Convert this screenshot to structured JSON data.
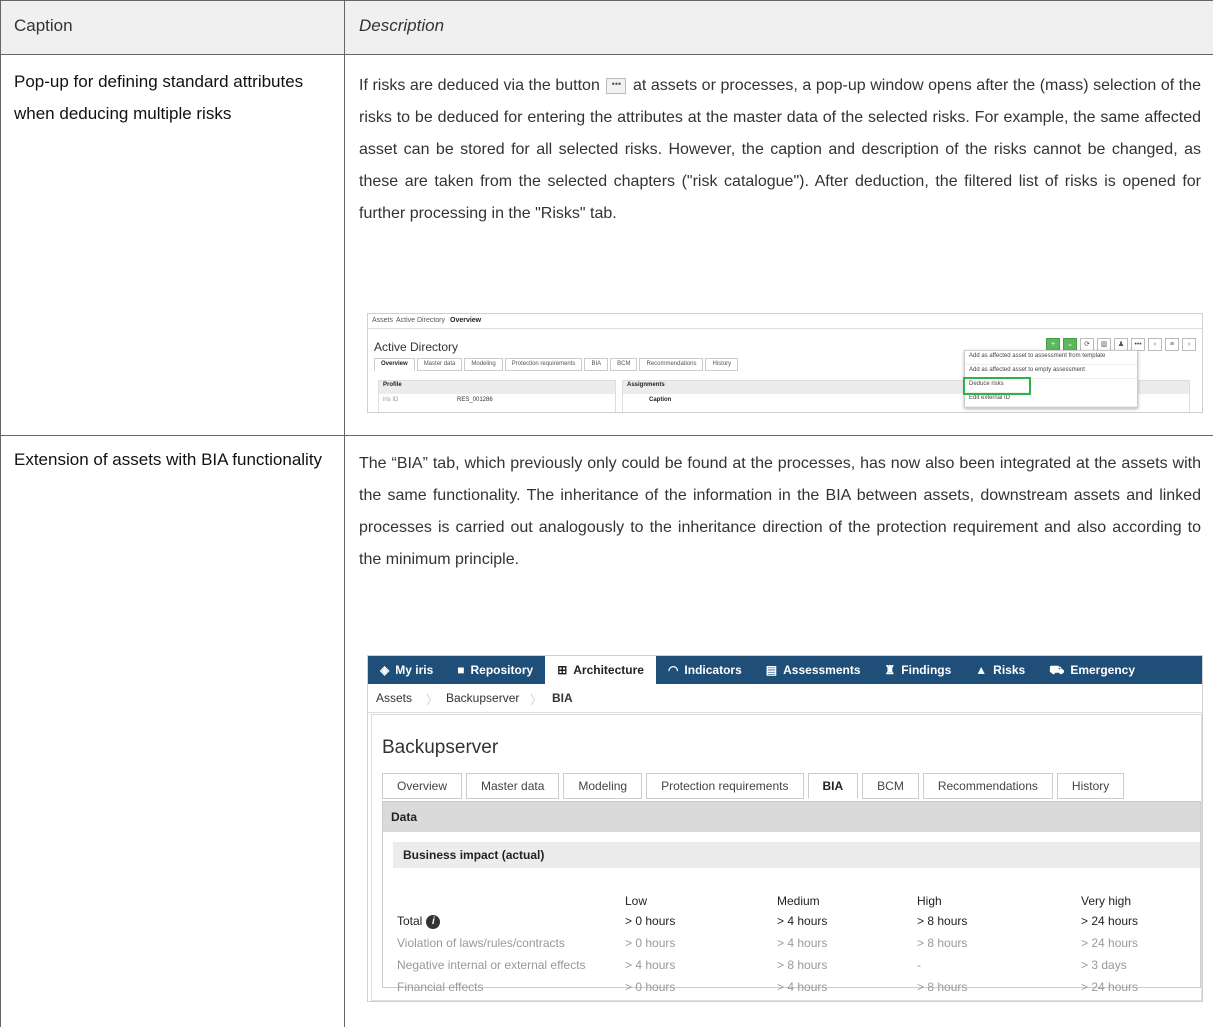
{
  "header": {
    "caption": "Caption",
    "description": "Description"
  },
  "row1": {
    "caption": "Pop-up for defining standard attributes when deducing multiple risks",
    "para_part1": "If risks are deduced via the button",
    "para_part2": "at assets or processes, a pop-up window opens after the (mass) selection of the risks to be deduced for entering the attributes at the master data of the selected risks. For example, the same affected asset can be stored for all selected risks. However, the caption and description of the risks cannot be changed, as these are taken from the selected chapters (\"risk catalogue\"). After deduction, the filtered list of risks is opened for further processing in the \"Risks\" tab.",
    "inline_button_icon": "more-dots-icon",
    "screenshot": {
      "breadcrumb": [
        "Assets",
        "Active Directory",
        "Overview"
      ],
      "title": "Active Directory",
      "tabs": [
        "Overview",
        "Master data",
        "Modeling",
        "Protection requirements",
        "BIA",
        "BCM",
        "Recommendations",
        "History"
      ],
      "left_panel_header": "Profile",
      "left_label": "iris ID",
      "left_value": "RES_001286",
      "right_panel_header": "Assignments",
      "right_col": "Caption",
      "menu_items": [
        "Add as affected asset to assessment from template",
        "Add as affected asset to empty assessment",
        "Deduce risks",
        "Edit external ID"
      ],
      "highlight_color": "#2db34a"
    }
  },
  "row2": {
    "caption": "Extension of assets with BIA functionality",
    "para": "The “BIA” tab, which previously only could be found at the processes, has now also been integrated at the assets with the same functionality. The inheritance of the information in the BIA between assets, downstream assets and linked processes is carried out analogously to the inheritance direction of the protection requirement and also according to the minimum principle.",
    "screenshot": {
      "nav": [
        {
          "label": "My iris",
          "icon": "diamond-icon",
          "glyph": "◈"
        },
        {
          "label": "Repository",
          "icon": "book-icon",
          "glyph": "■"
        },
        {
          "label": "Architecture",
          "icon": "sitemap-icon",
          "glyph": "⊞"
        },
        {
          "label": "Indicators",
          "icon": "gauge-icon",
          "glyph": "◠"
        },
        {
          "label": "Assessments",
          "icon": "clipboard-icon",
          "glyph": "▤"
        },
        {
          "label": "Findings",
          "icon": "binoculars-icon",
          "glyph": "♜"
        },
        {
          "label": "Risks",
          "icon": "warning-icon",
          "glyph": "▲"
        },
        {
          "label": "Emergency",
          "icon": "ambulance-icon",
          "glyph": "⛟"
        }
      ],
      "nav_color": "#1f4e79",
      "breadcrumb": [
        "Assets",
        "Backupserver",
        "BIA"
      ],
      "title": "Backupserver",
      "tabs": [
        "Overview",
        "Master data",
        "Modeling",
        "Protection requirements",
        "BIA",
        "BCM",
        "Recommendations",
        "History"
      ],
      "data_header": "Data",
      "section_header": "Business impact (actual)",
      "columns": [
        "Low",
        "Medium",
        "High",
        "Very high"
      ],
      "rows": [
        {
          "label": "Total",
          "values": [
            "> 0 hours",
            "> 4 hours",
            "> 8 hours",
            "> 24 hours"
          ]
        },
        {
          "label": "Violation of laws/rules/contracts",
          "values": [
            "> 0 hours",
            "> 4 hours",
            "> 8 hours",
            "> 24 hours"
          ]
        },
        {
          "label": "Negative internal or external effects",
          "values": [
            "> 4 hours",
            "> 8 hours",
            "-",
            "> 3 days"
          ]
        },
        {
          "label": "Financial effects",
          "values": [
            "> 0 hours",
            "> 4 hours",
            "> 8 hours",
            "> 24 hours"
          ]
        }
      ]
    }
  }
}
